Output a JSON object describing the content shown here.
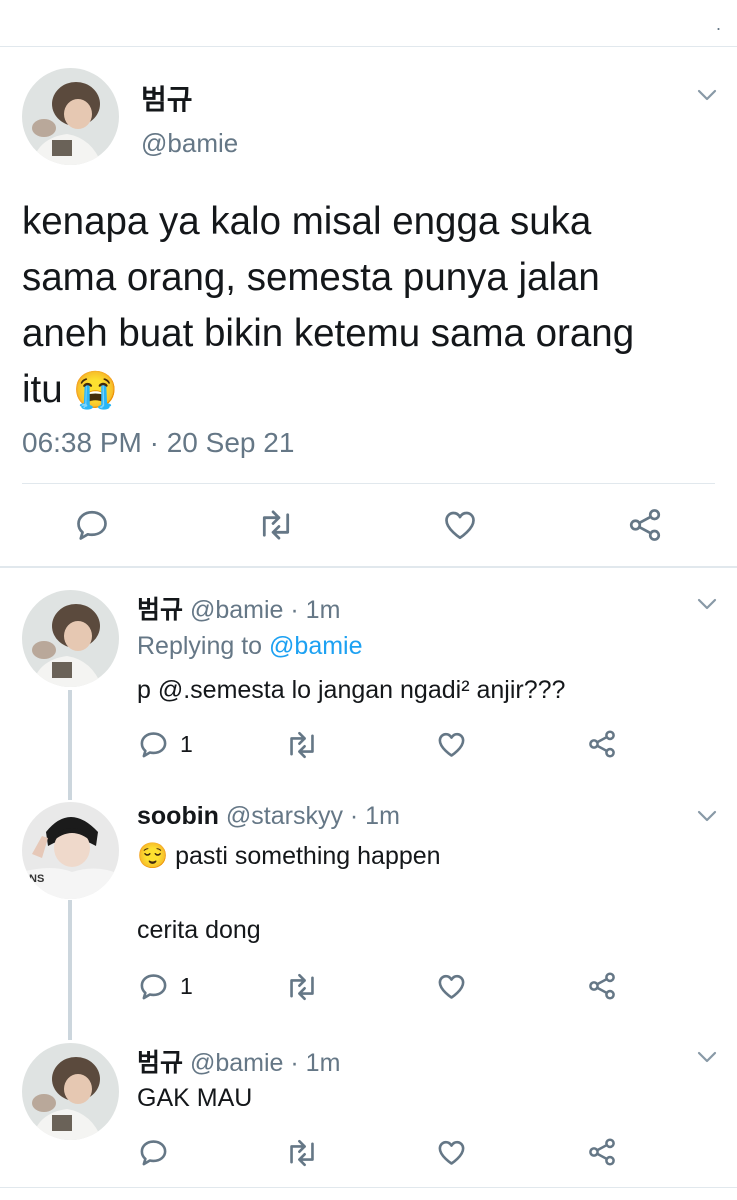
{
  "top_status": {
    "dot": "."
  },
  "main_tweet": {
    "display_name": "범규",
    "handle": "@bamie",
    "text_lines": [
      "kenapa ya kalo misal engga suka",
      "sama orang, semesta punya jalan",
      "aneh buat bikin ketemu sama orang",
      "itu"
    ],
    "emoji": "😭",
    "timestamp": "06:38 PM · 20 Sep 21",
    "actions": [
      "reply-icon",
      "retweet-icon",
      "like-icon",
      "share-icon"
    ]
  },
  "replies": [
    {
      "display_name": "범규",
      "handle": "@bamie",
      "time": "· 1m",
      "replying_label": "Replying to",
      "replying_to": "@bamie",
      "text": "p @.semesta lo jangan ngadi² anjir???",
      "reply_count": "1"
    },
    {
      "display_name": "soobin",
      "handle": "@starskyy",
      "time": "· 1m",
      "emoji": "😌",
      "text": "pasti something happen",
      "text2": "cerita dong",
      "reply_count": "1"
    },
    {
      "display_name": "범규",
      "handle": "@bamie",
      "time": "· 1m",
      "text": "GAK MAU",
      "reply_count": ""
    }
  ],
  "colors": {
    "text": "#14171a",
    "muted": "#657786",
    "link": "#1da1f2",
    "divider": "#e1e8ed",
    "thread_line": "#ccd6dd"
  }
}
